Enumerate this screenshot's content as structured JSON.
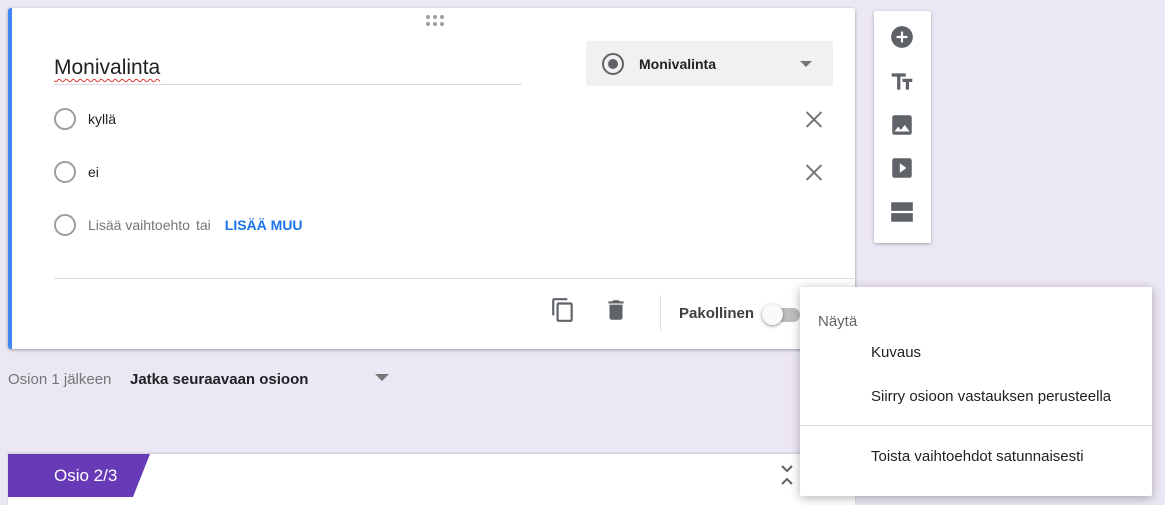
{
  "question": {
    "title": "Monivalinta",
    "type_select": {
      "selected": "Monivalinta",
      "icon": "radio-button-icon"
    },
    "options": [
      {
        "label": "kyllä"
      },
      {
        "label": "ei"
      }
    ],
    "add_option": {
      "placeholder": "Lisää vaihtoehto",
      "or_text": "tai",
      "add_other_label": "LISÄÄ MUU"
    },
    "footer": {
      "required_label": "Pakollinen",
      "required_on": false,
      "icons": [
        "duplicate-icon",
        "delete-icon",
        "more-options-icon"
      ]
    }
  },
  "toolbar": {
    "icons": [
      "add-question-icon",
      "add-title-icon",
      "add-image-icon",
      "add-video-icon",
      "add-section-icon"
    ]
  },
  "after_section": {
    "label": "Osion 1 jälkeen",
    "value": "Jatka seuraavaan osioon"
  },
  "section2": {
    "label": "Osio 2/3"
  },
  "menu": {
    "header": "Näytä",
    "items": [
      "Kuvaus",
      "Siirry osioon vastauksen perusteella",
      "Toista vaihtoehdot satunnaisesti"
    ]
  },
  "colors": {
    "background": "#ece7f5",
    "accent_blue": "#4285f4",
    "link_blue": "#1a73e8",
    "section_purple": "#673ab7"
  }
}
